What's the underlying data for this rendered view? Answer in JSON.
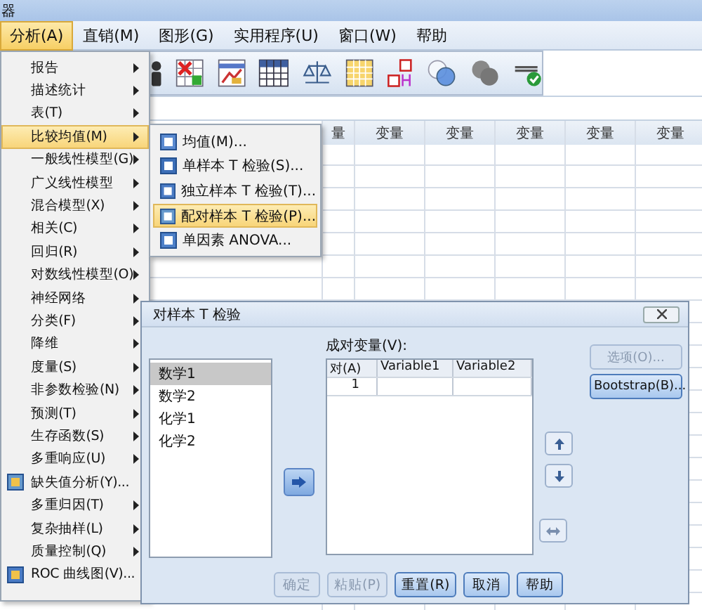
{
  "window": {
    "title": "器"
  },
  "menubar": [
    {
      "label": "分析(A)",
      "selected": true
    },
    {
      "label": "直销(M)",
      "selected": false
    },
    {
      "label": "图形(G)",
      "selected": false
    },
    {
      "label": "实用程序(U)",
      "selected": false
    },
    {
      "label": "窗口(W)",
      "selected": false
    },
    {
      "label": "帮助",
      "selected": false
    }
  ],
  "grid": {
    "columns": [
      "量",
      "变量",
      "变量",
      "变量",
      "变量",
      "变量"
    ]
  },
  "analyze_menu": [
    {
      "label": "报告",
      "kind": "submenu",
      "selected": false
    },
    {
      "label": "描述统计",
      "kind": "submenu",
      "selected": false
    },
    {
      "label": "表(T)",
      "kind": "submenu",
      "selected": false
    },
    {
      "label": "比较均值(M)",
      "kind": "submenu",
      "selected": true
    },
    {
      "label": "一般线性模型(G)",
      "kind": "submenu",
      "selected": false
    },
    {
      "label": "广义线性模型",
      "kind": "submenu",
      "selected": false
    },
    {
      "label": "混合模型(X)",
      "kind": "submenu",
      "selected": false
    },
    {
      "label": "相关(C)",
      "kind": "submenu",
      "selected": false
    },
    {
      "label": "回归(R)",
      "kind": "submenu",
      "selected": false
    },
    {
      "label": "对数线性模型(O)",
      "kind": "submenu",
      "selected": false
    },
    {
      "label": "神经网络",
      "kind": "submenu",
      "selected": false
    },
    {
      "label": "分类(F)",
      "kind": "submenu",
      "selected": false
    },
    {
      "label": "降维",
      "kind": "submenu",
      "selected": false
    },
    {
      "label": "度量(S)",
      "kind": "submenu",
      "selected": false
    },
    {
      "label": "非参数检验(N)",
      "kind": "submenu",
      "selected": false
    },
    {
      "label": "预测(T)",
      "kind": "submenu",
      "selected": false
    },
    {
      "label": "生存函数(S)",
      "kind": "submenu",
      "selected": false
    },
    {
      "label": "多重响应(U)",
      "kind": "submenu",
      "selected": false
    },
    {
      "label": "缺失值分析(Y)...",
      "kind": "action",
      "selected": false
    },
    {
      "label": "多重归因(T)",
      "kind": "submenu",
      "selected": false
    },
    {
      "label": "复杂抽样(L)",
      "kind": "submenu",
      "selected": false
    },
    {
      "label": "质量控制(Q)",
      "kind": "submenu",
      "selected": false
    },
    {
      "label": "ROC 曲线图(V)...",
      "kind": "action",
      "selected": false
    }
  ],
  "compare_means_menu": [
    {
      "label": "均值(M)...",
      "selected": false
    },
    {
      "label": "单样本 T 检验(S)...",
      "selected": false
    },
    {
      "label": "独立样本 T 检验(T)...",
      "selected": false
    },
    {
      "label": "配对样本 T 检验(P)...",
      "selected": true
    },
    {
      "label": "单因素 ANOVA...",
      "selected": false
    }
  ],
  "dialog": {
    "title": "对样本 T 检验",
    "variables": [
      {
        "label": "数学1",
        "selected": true
      },
      {
        "label": "数学2",
        "selected": false
      },
      {
        "label": "化学1",
        "selected": false
      },
      {
        "label": "化学2",
        "selected": false
      }
    ],
    "pairs_label": "成对变量(V):",
    "pairs_columns": [
      "对(A)",
      "Variable1",
      "Variable2"
    ],
    "pairs_rows": [
      {
        "pair": "1"
      }
    ],
    "side_buttons": [
      {
        "label": "选项(O)...",
        "disabled": true
      },
      {
        "label": "Bootstrap(B)...",
        "disabled": false
      }
    ],
    "footer_buttons": [
      {
        "label": "确定",
        "disabled": true
      },
      {
        "label": "粘贴(P)",
        "disabled": true
      },
      {
        "label": "重置(R)",
        "disabled": false
      },
      {
        "label": "取消",
        "disabled": false
      },
      {
        "label": "帮助",
        "disabled": false
      }
    ]
  }
}
